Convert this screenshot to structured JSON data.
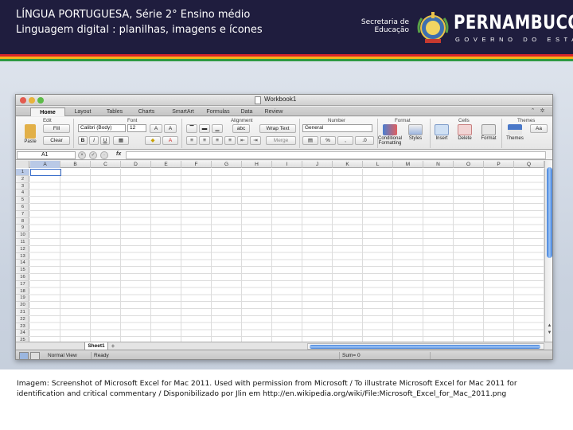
{
  "slide": {
    "title_line1": "LÍNGUA PORTUGUESA,  Série  2° Ensino médio",
    "title_line2": "Linguagem digital : planilhas, imagens e ícones",
    "logo": {
      "secretaria_line1": "Secretaria de",
      "secretaria_line2": "Educação",
      "brand": "PERNAMBUCO",
      "brand_sub": "GOVERNO DO ESTADO"
    },
    "colors": {
      "header_bg": "#1f1d3e",
      "stripe_red": "#d8262a",
      "stripe_yellow": "#f6b31a",
      "stripe_green": "#2e9a43"
    },
    "caption": "Imagem: Screenshot of Microsoft Excel for Mac 2011. Used with permission from Microsoft / To illustrate Microsoft Excel for Mac 2011 for identification and critical commentary / Disponibilizado por Jlin em http://en.wikipedia.org/wiki/File:Microsoft_Excel_for_Mac_2011.png"
  },
  "excel": {
    "window_title": "Workbook1",
    "tabs": [
      "Home",
      "Layout",
      "Tables",
      "Charts",
      "SmartArt",
      "Formulas",
      "Data",
      "Review"
    ],
    "active_tab": "Home",
    "groups": {
      "edit": "Edit",
      "font": "Font",
      "alignment": "Alignment",
      "number": "Number",
      "format": "Format",
      "cells": "Cells",
      "themes": "Themes"
    },
    "ribbon": {
      "paste": "Paste",
      "fill": "Fill",
      "clear": "Clear",
      "font_name": "Calibri (Body)",
      "font_size": "12",
      "bold": "B",
      "italic": "I",
      "underline": "U",
      "abc": "abc",
      "wrap_text": "Wrap Text",
      "merge": "Merge",
      "number_format": "General",
      "conditional_formatting_line1": "Conditional",
      "conditional_formatting_line2": "Formatting",
      "styles": "Styles",
      "insert": "Insert",
      "delete": "Delete",
      "format": "Format",
      "themes": "Themes",
      "aa": "Aa"
    },
    "name_box": "A1",
    "fx": "fx",
    "columns": [
      "A",
      "B",
      "C",
      "D",
      "E",
      "F",
      "G",
      "H",
      "I",
      "J",
      "K",
      "L",
      "M",
      "N",
      "O",
      "P",
      "Q"
    ],
    "rows": [
      "1",
      "2",
      "3",
      "4",
      "5",
      "6",
      "7",
      "8",
      "9",
      "10",
      "11",
      "12",
      "13",
      "14",
      "15",
      "16",
      "17",
      "18",
      "19",
      "20",
      "21",
      "22",
      "23",
      "24",
      "25"
    ],
    "active_cell": "A1",
    "sheet_tab": "Sheet1",
    "add_sheet": "+",
    "status": {
      "view": "Normal View",
      "ready": "Ready",
      "sum": "Sum= 0"
    }
  }
}
